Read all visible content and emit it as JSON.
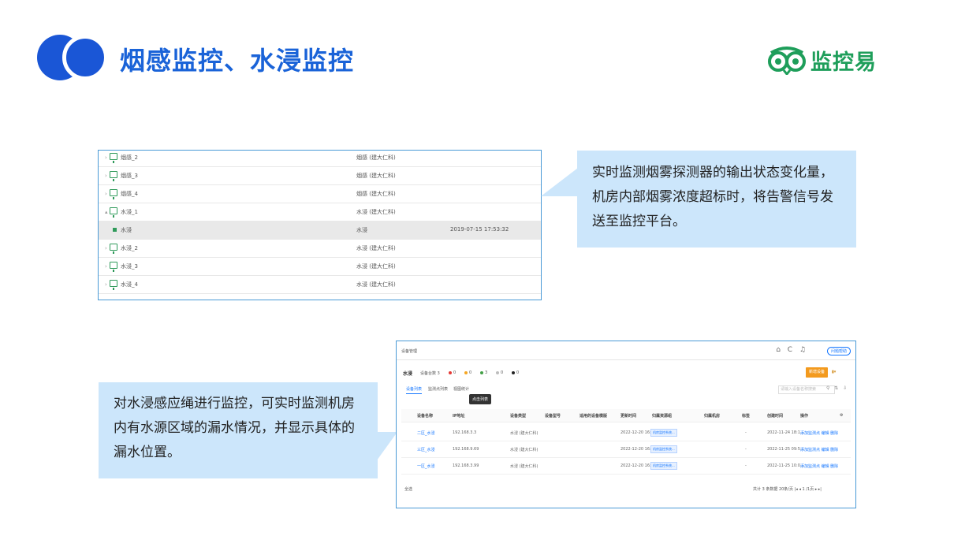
{
  "colors": {
    "accent": "#1a56d6",
    "title": "#1a63d8",
    "brand": "#1e9e5a",
    "callout_bg": "#cce6fb",
    "frame": "#4a9ad6"
  },
  "header": {
    "title": "烟感监控、水浸监控"
  },
  "brand": {
    "name": "监控易",
    "icon": "owl-icon"
  },
  "tree": {
    "rows": [
      {
        "name": "烟感_2",
        "type": "烟感 (建大仁科)",
        "time": ""
      },
      {
        "name": "烟感_3",
        "type": "烟感 (建大仁科)",
        "time": ""
      },
      {
        "name": "烟感_4",
        "type": "烟感 (建大仁科)",
        "time": ""
      },
      {
        "name": "水浸_1",
        "type": "水浸 (建大仁科)",
        "time": ""
      },
      {
        "name": "水浸",
        "type": "水浸",
        "time": "2019-07-15 17:53:32"
      },
      {
        "name": "水浸_2",
        "type": "水浸 (建大仁科)",
        "time": ""
      },
      {
        "name": "水浸_3",
        "type": "水浸 (建大仁科)",
        "time": ""
      },
      {
        "name": "水浸_4",
        "type": "水浸 (建大仁科)",
        "time": ""
      }
    ]
  },
  "callouts": {
    "smoke": "实时监测烟雾探测器的输出状态变化量，机房内部烟雾浓度超标时，将告警信号发送至监控平台。",
    "water": "对水浸感应绳进行监控，可实时监测机房内有水源区域的漏水情况，并显示具体的漏水位置。"
  },
  "device_panel": {
    "breadcrumb": "设备管理",
    "help": "问题帮助",
    "group": "水浸",
    "count": "设备台数 3",
    "stats": [
      "0",
      "0",
      "3",
      "0",
      "0"
    ],
    "add_button": "新增设备",
    "tabs": [
      "设备列表",
      "监测点列表",
      "视图统计"
    ],
    "tooltip": "点击列表",
    "search_placeholder": "请输入设备名称搜索",
    "columns": [
      "设备名称",
      "IP地址",
      "设备类型",
      "设备型号",
      "适用的设备模版",
      "更新时间",
      "归属资源组",
      "归属机房",
      "标签",
      "创建时间",
      "操作"
    ],
    "rows": [
      {
        "name": "二区_水浸",
        "ip": "192.168.3.3",
        "type": "水浸 (建大仁科)",
        "updated": "2022-12-20 16:2...",
        "group": "机房监控系统...",
        "owner": "-",
        "created": "2022-11-24 18:1...",
        "ops": "添加监测点 编辑 删除"
      },
      {
        "name": "三区_水浸",
        "ip": "192.168.9.69",
        "type": "水浸 (建大仁科)",
        "updated": "2022-12-20 16:2...",
        "group": "机房监控系统...",
        "owner": "-",
        "created": "2022-11-25 09:5...",
        "ops": "添加监测点 编辑 删除"
      },
      {
        "name": "一区_水浸",
        "ip": "192.168.3.99",
        "type": "水浸 (建大仁科)",
        "updated": "2022-12-20 16:2...",
        "group": "机房监控系统...",
        "owner": "-",
        "created": "2022-11-25 10:0...",
        "ops": "添加监测点 编辑 删除"
      }
    ],
    "select_all": "全选",
    "pager": "共计 3 条数据   20条/页   |◂  ◂  1   /1页  ▸  ▸|"
  }
}
